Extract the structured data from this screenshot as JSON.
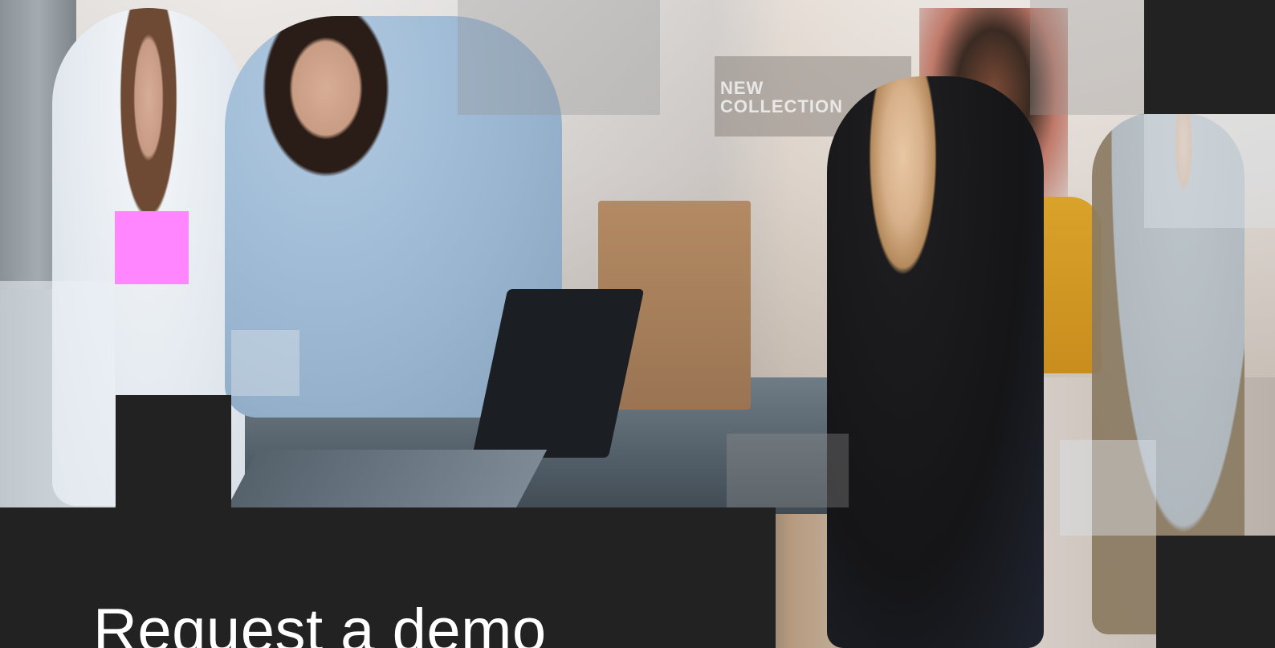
{
  "hero": {
    "headline": "Request a demo",
    "photo_sign": "NEW\nCOLLECTION",
    "accent_color": "#ff86ff",
    "background_color": "#222222"
  }
}
